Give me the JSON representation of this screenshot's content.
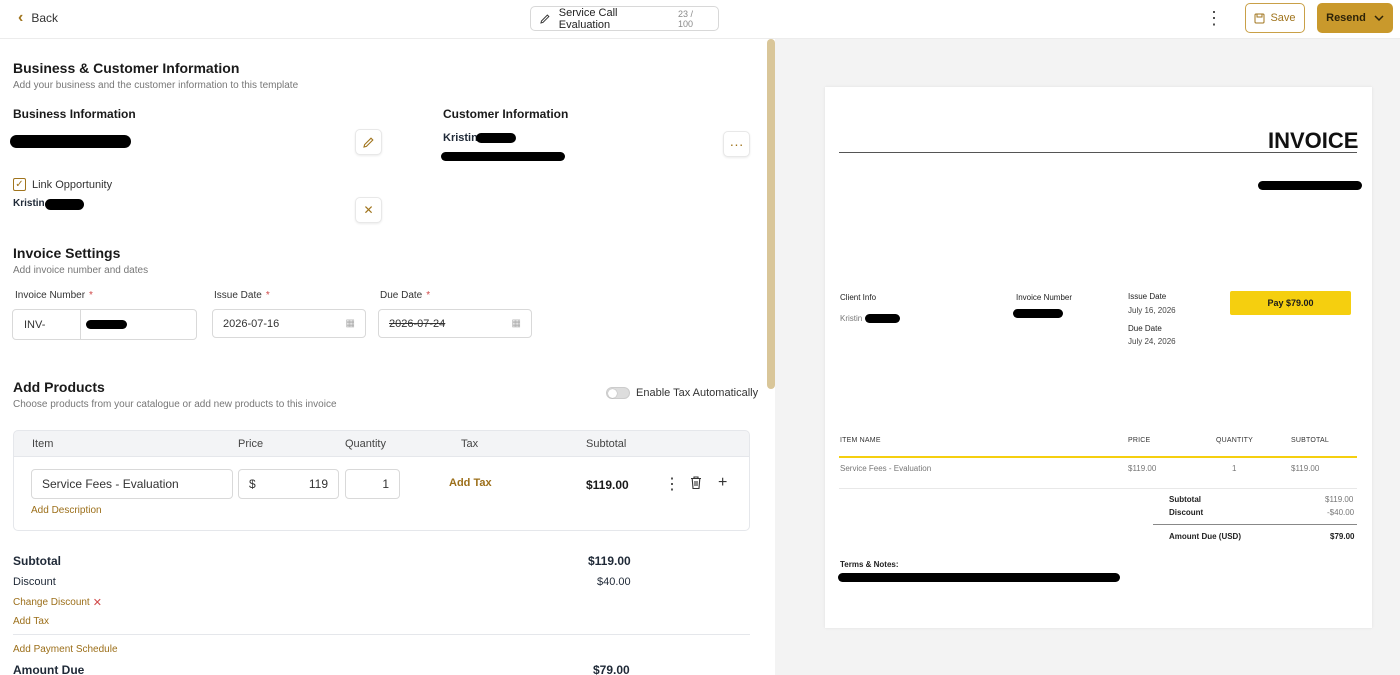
{
  "topbar": {
    "back_label": "Back",
    "doc_title": "Service Call Evaluation",
    "char_count": "23 / 100",
    "save_label": "Save",
    "resend_label": "Resend"
  },
  "business_customer": {
    "title": "Business & Customer Information",
    "subtitle": "Add your business and the customer information to this template",
    "business_heading": "Business Information",
    "customer_heading": "Customer Information",
    "customer_name": "Kristin",
    "link_opportunity_label": "Link Opportunity",
    "opportunity_name": "Kristin"
  },
  "invoice_settings": {
    "title": "Invoice Settings",
    "subtitle": "Add invoice number and dates",
    "number_label": "Invoice Number",
    "number_prefix": "INV-",
    "issue_label": "Issue Date",
    "issue_value": "2026-07-16",
    "due_label": "Due Date",
    "due_value": "2026-07-24",
    "required_mark": "*"
  },
  "products": {
    "title": "Add Products",
    "subtitle": "Choose products from your catalogue or add new products to this invoice",
    "tax_toggle_label": "Enable Tax Automatically",
    "columns": [
      "Item",
      "Price",
      "Quantity",
      "Tax",
      "Subtotal"
    ],
    "row": {
      "item": "Service Fees - Evaluation",
      "currency": "$",
      "price": "119",
      "quantity": "1",
      "add_tax": "Add Tax",
      "subtotal": "$119.00",
      "add_description": "Add Description"
    }
  },
  "totals": {
    "subtotal_label": "Subtotal",
    "subtotal_value": "$119.00",
    "discount_label": "Discount",
    "discount_value": "$40.00",
    "change_discount": "Change Discount",
    "remove_icon": "✕",
    "add_tax": "Add Tax",
    "add_payment_schedule": "Add Payment Schedule",
    "amount_due_label": "Amount Due",
    "amount_due_value": "$79.00"
  },
  "preview": {
    "heading": "INVOICE",
    "client_info_label": "Client Info",
    "client_name": "Kristin",
    "invoice_number_label": "Invoice Number",
    "issue_date_label": "Issue Date",
    "issue_date_value": "July 16, 2026",
    "due_date_label": "Due Date",
    "due_date_value": "July 24, 2026",
    "pay_button": "Pay $79.00",
    "table_headers": [
      "ITEM NAME",
      "PRICE",
      "QUANTITY",
      "SUBTOTAL"
    ],
    "row": {
      "item": "Service Fees - Evaluation",
      "price": "$119.00",
      "quantity": "1",
      "subtotal": "$119.00"
    },
    "subtotal_label": "Subtotal",
    "subtotal_value": "$119.00",
    "discount_label": "Discount",
    "discount_value": "-$40.00",
    "amount_due_label": "Amount Due (USD)",
    "amount_due_value": "$79.00",
    "terms_label": "Terms & Notes:"
  },
  "colors": {
    "accent": "#a0741d",
    "resend_bg": "#c9992c",
    "pay_bg": "#f5cf0f",
    "required": "#d04848"
  }
}
